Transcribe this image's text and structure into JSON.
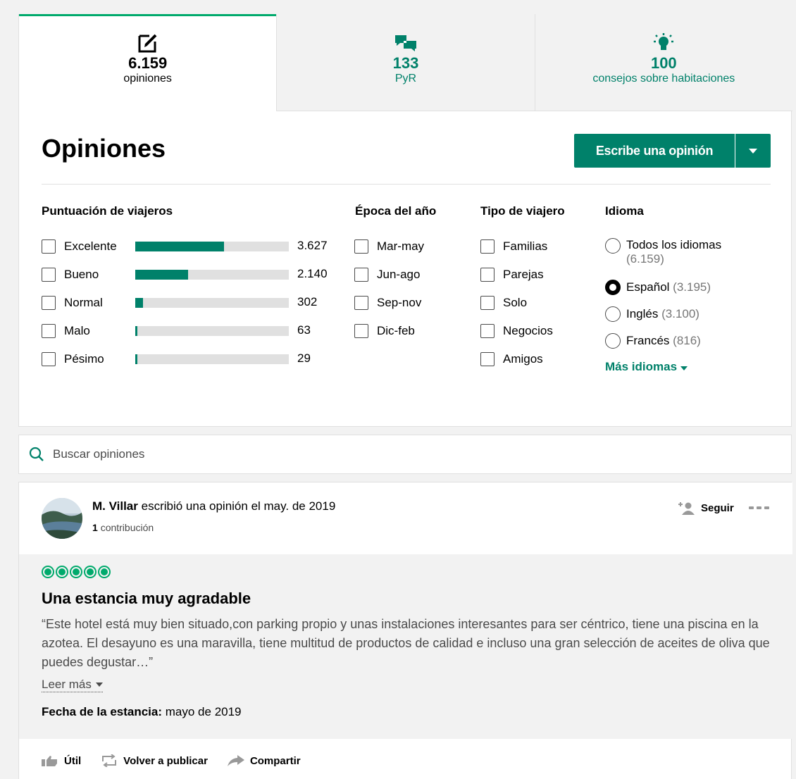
{
  "tabs": [
    {
      "count": "6.159",
      "label": "opiniones",
      "icon": "edit-icon"
    },
    {
      "count": "133",
      "label": "PyR",
      "icon": "chat-icon"
    },
    {
      "count": "100",
      "label": "consejos sobre habitaciones",
      "icon": "lightbulb-icon"
    }
  ],
  "header": {
    "title": "Opiniones",
    "write_label": "Escribe una opinión"
  },
  "filters": {
    "rating": {
      "title": "Puntuación de viajeros",
      "items": [
        {
          "label": "Excelente",
          "count": "3.627",
          "value": 3627
        },
        {
          "label": "Bueno",
          "count": "2.140",
          "value": 2140
        },
        {
          "label": "Normal",
          "count": "302",
          "value": 302
        },
        {
          "label": "Malo",
          "count": "63",
          "value": 63
        },
        {
          "label": "Pésimo",
          "count": "29",
          "value": 29
        }
      ]
    },
    "season": {
      "title": "Época del año",
      "items": [
        "Mar-may",
        "Jun-ago",
        "Sep-nov",
        "Dic-feb"
      ]
    },
    "traveler": {
      "title": "Tipo de viajero",
      "items": [
        "Familias",
        "Parejas",
        "Solo",
        "Negocios",
        "Amigos"
      ]
    },
    "language": {
      "title": "Idioma",
      "items": [
        {
          "label": "Todos los idiomas",
          "count": "(6.159)",
          "selected": false
        },
        {
          "label": "Español",
          "count": "(3.195)",
          "selected": true
        },
        {
          "label": "Inglés",
          "count": "(3.100)",
          "selected": false
        },
        {
          "label": "Francés",
          "count": "(816)",
          "selected": false
        }
      ],
      "more": "Más idiomas"
    }
  },
  "search": {
    "placeholder": "Buscar opiniones"
  },
  "review": {
    "author": "M. Villar",
    "action": "escribió una opinión el may. de 2019",
    "contrib_count": "1",
    "contrib_label": "contribución",
    "follow": "Seguir",
    "rating": 5,
    "title": "Una estancia muy agradable",
    "text": "“Este hotel está muy bien situado,con parking propio y unas instalaciones interesantes para ser céntrico, tiene una piscina en la azotea. El desayuno es una maravilla, tiene multitud de productos de calidad e incluso una gran selección de aceites de oliva que puedes degustar…”",
    "read_more": "Leer más",
    "stay_label": "Fecha de la estancia:",
    "stay_value": "mayo de 2019",
    "actions": {
      "useful": "Útil",
      "repost": "Volver a publicar",
      "share": "Compartir"
    }
  },
  "colors": {
    "accent": "#00816a",
    "bubble": "#00aa6c"
  }
}
